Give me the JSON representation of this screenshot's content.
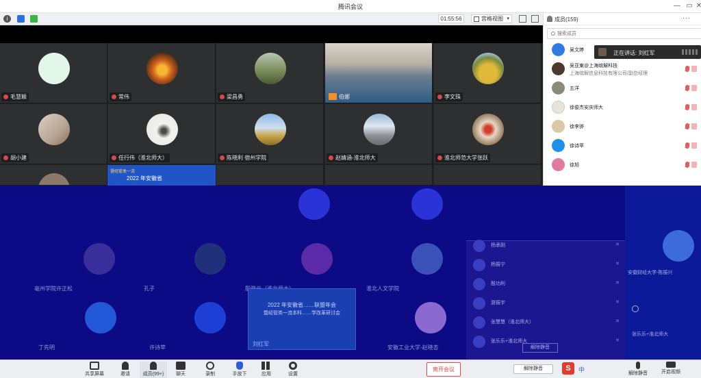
{
  "window": {
    "title": "腾讯会议"
  },
  "toolbar": {
    "timer": "01:55:56",
    "view_label": "宫格视图"
  },
  "gallery_tiles": [
    {
      "name": "毛慧颖"
    },
    {
      "name": "常伟"
    },
    {
      "name": "梁昌勇"
    },
    {
      "name": "伯娜"
    },
    {
      "name": "李文珠"
    },
    {
      "name": "胡小建"
    },
    {
      "name": "任行伟（淮北师大）"
    },
    {
      "name": "陈晓利 宿州学院"
    },
    {
      "name": "赵婧涵-淮北师大"
    },
    {
      "name": "淮北师范大学张跃"
    }
  ],
  "presenter_slide": {
    "heading": "2022 年安徽省",
    "subtitle": "暨经管类一流"
  },
  "blue_tiles": [
    {
      "name": "亳州学院许正松"
    },
    {
      "name": "孔子"
    },
    {
      "name": "殷晓云（淮北师大）"
    },
    {
      "name": "淮北人文学院"
    },
    {
      "name": "丁先明"
    },
    {
      "name": "许诗苹"
    },
    {
      "name": "安徽工业大学-赵晓杏"
    }
  ],
  "blue_slide": {
    "line1": "2022 年安徽省……联盟年会",
    "line2": "暨经管类一流本科……学改革研讨会",
    "name": "刘红军"
  },
  "blue_members": [
    {
      "name": "杨承刚"
    },
    {
      "name": "杨振宁"
    },
    {
      "name": "殷功利"
    },
    {
      "name": "游振宇"
    },
    {
      "name": "张慧慧（淮北师大）"
    },
    {
      "name": "张乐乐+淮北师大"
    }
  ],
  "blue_members_unmute_all": "解除静音",
  "blue_right": {
    "name1": "安徽财经大学-陈振兴",
    "name2": "张乐乐+淮北师大"
  },
  "panel": {
    "title": "成员(159)",
    "more": "···",
    "search_placeholder": "搜索成员",
    "speaking_text": "正在讲话: 刘红军",
    "members": [
      {
        "name": "吴文婷",
        "sub": ""
      },
      {
        "name": "吴亚東@上海缤解科技",
        "sub": "上海缤解信息科技有限公司/副总经理"
      },
      {
        "name": "五洋",
        "sub": ""
      },
      {
        "name": "徐俊杰安庆师大",
        "sub": ""
      },
      {
        "name": "徐李骅",
        "sub": ""
      },
      {
        "name": "徐诗苹",
        "sub": ""
      },
      {
        "name": "徐旭",
        "sub": ""
      }
    ]
  },
  "bottom": {
    "buttons": [
      {
        "label": "共享屏幕"
      },
      {
        "label": "邀请"
      },
      {
        "label": "成员(99+)"
      },
      {
        "label": "聊天"
      },
      {
        "label": "录制"
      },
      {
        "label": "手放下"
      },
      {
        "label": "应用"
      },
      {
        "label": "设置"
      }
    ],
    "leave": "离开会议",
    "unmute_all": "解除静音",
    "ime": {
      "s": "S",
      "zh": "中"
    },
    "right_buttons": [
      {
        "label": "解除静音"
      },
      {
        "label": "开启视频"
      }
    ]
  }
}
